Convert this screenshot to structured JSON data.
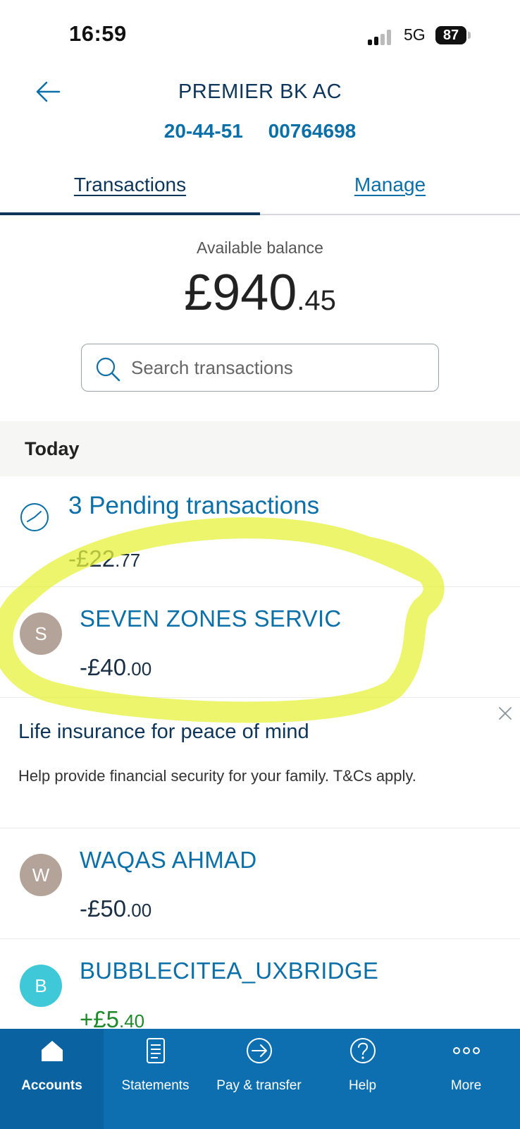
{
  "status_bar": {
    "time": "16:59",
    "network": "5G",
    "battery": "87"
  },
  "header": {
    "account_name": "PREMIER BK AC",
    "sort_code": "20-44-51",
    "account_number": "00764698"
  },
  "tabs": [
    {
      "label": "Transactions",
      "active": true
    },
    {
      "label": "Manage",
      "active": false
    }
  ],
  "balance": {
    "label": "Available balance",
    "major": "£940",
    "minor": ".45"
  },
  "search": {
    "placeholder": "Search transactions"
  },
  "section": {
    "title": "Today"
  },
  "pending": {
    "title": "3 Pending transactions",
    "amount_major": "-£22",
    "amount_minor": ".77"
  },
  "transactions": [
    {
      "initial": "S",
      "name": "SEVEN ZONES SERVIC",
      "amount_major": "-£40",
      "amount_minor": ".00",
      "avatar_color": "#b3a398"
    },
    {
      "initial": "W",
      "name": "WAQAS AHMAD",
      "amount_major": "-£50",
      "amount_minor": ".00",
      "avatar_color": "#b3a398"
    },
    {
      "initial": "B",
      "name": "BUBBLECITEA_UXBRIDGE",
      "amount_major": "+£5",
      "amount_minor": ".40",
      "avatar_color": "#3ec8d8"
    }
  ],
  "promo": {
    "title": "Life insurance for peace of mind",
    "body": "Help provide financial security for your family. T&Cs apply."
  },
  "bottom_nav": [
    {
      "label": "Accounts",
      "icon": "home-icon",
      "active": true
    },
    {
      "label": "Statements",
      "icon": "document-icon",
      "active": false
    },
    {
      "label": "Pay & transfer",
      "icon": "arrow-circle-icon",
      "active": false
    },
    {
      "label": "Help",
      "icon": "question-icon",
      "active": false
    },
    {
      "label": "More",
      "icon": "dots-icon",
      "active": false
    }
  ],
  "colors": {
    "brand_blue": "#0b6fa8",
    "navy": "#0c3559",
    "tabbar": "#0d6faf",
    "positive_green": "#1e8a2a",
    "highlight": "#e6f23a"
  }
}
